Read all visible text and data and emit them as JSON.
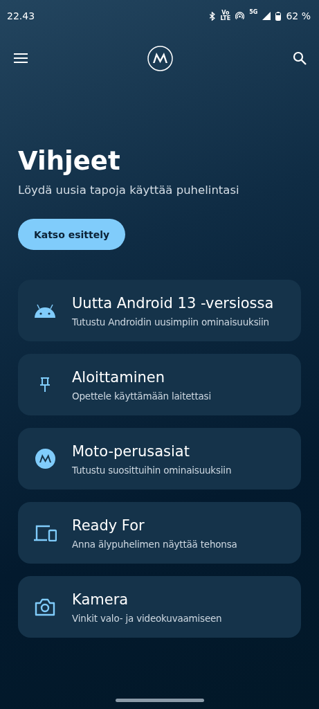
{
  "status_bar": {
    "time": "22.43",
    "volte_top": "Vo",
    "volte_bottom": "LTE",
    "network": "5G",
    "battery": "62 %"
  },
  "header": {
    "title": "Vihjeet",
    "subtitle": "Löydä uusia tapoja käyttää puhelintasi",
    "button": "Katso esittely"
  },
  "cards": [
    {
      "kind": "android",
      "title": "Uutta Android 13 -versiossa",
      "subtitle": "Tutustu Androidin uusimpiin ominaisuuksiin"
    },
    {
      "kind": "pin",
      "title": "Aloittaminen",
      "subtitle": "Opettele käyttämään laitettasi"
    },
    {
      "kind": "moto",
      "title": "Moto-perusasiat",
      "subtitle": "Tutustu suosittuihin ominaisuuksiin"
    },
    {
      "kind": "devices",
      "title": "Ready For",
      "subtitle": "Anna älypuhelimen näyttää tehonsa"
    },
    {
      "kind": "camera",
      "title": "Kamera",
      "subtitle": "Vinkit valo- ja videokuvaamiseen"
    }
  ]
}
